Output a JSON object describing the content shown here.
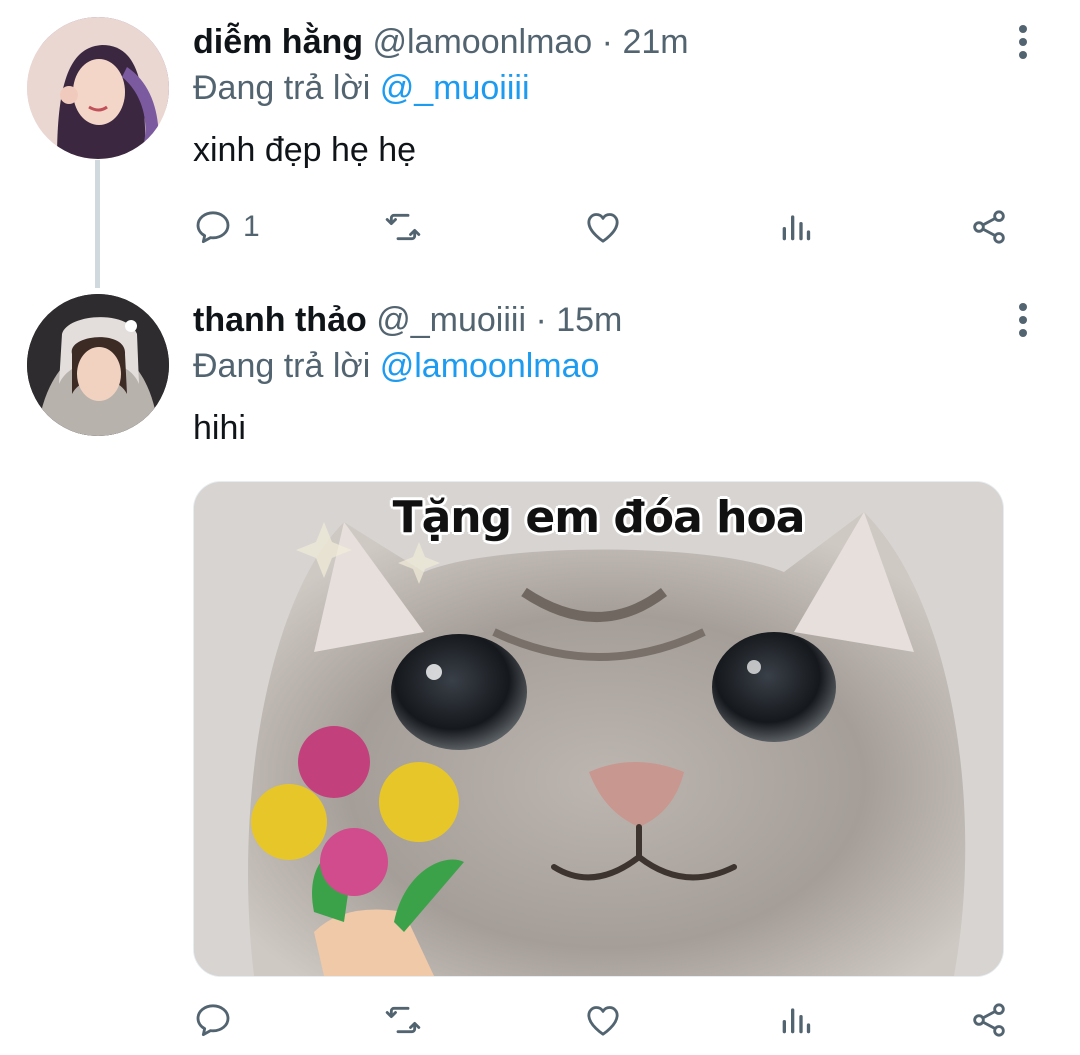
{
  "tweets": [
    {
      "name": "diễm hằng",
      "handle": "@lamoonlmao",
      "separator": "·",
      "time": "21m",
      "reply_prefix": "Đang trả lời",
      "reply_to": "@_muoiiii",
      "text": "xinh đẹp hẹ hẹ",
      "reply_count": "1"
    },
    {
      "name": "thanh thảo",
      "handle": "@_muoiiii",
      "separator": "·",
      "time": "15m",
      "reply_prefix": "Đang trả lời",
      "reply_to": "@lamoonlmao",
      "text": "hihi",
      "media_caption": "Tặng em đóa hoa"
    }
  ],
  "icons": [
    "reply-icon",
    "retweet-icon",
    "like-icon",
    "stats-icon",
    "share-icon",
    "more-icon"
  ],
  "colors": {
    "link": "#1d9bf0",
    "secondary": "#536471",
    "primary_text": "#0f1419",
    "thread_line": "#cfd9de"
  }
}
